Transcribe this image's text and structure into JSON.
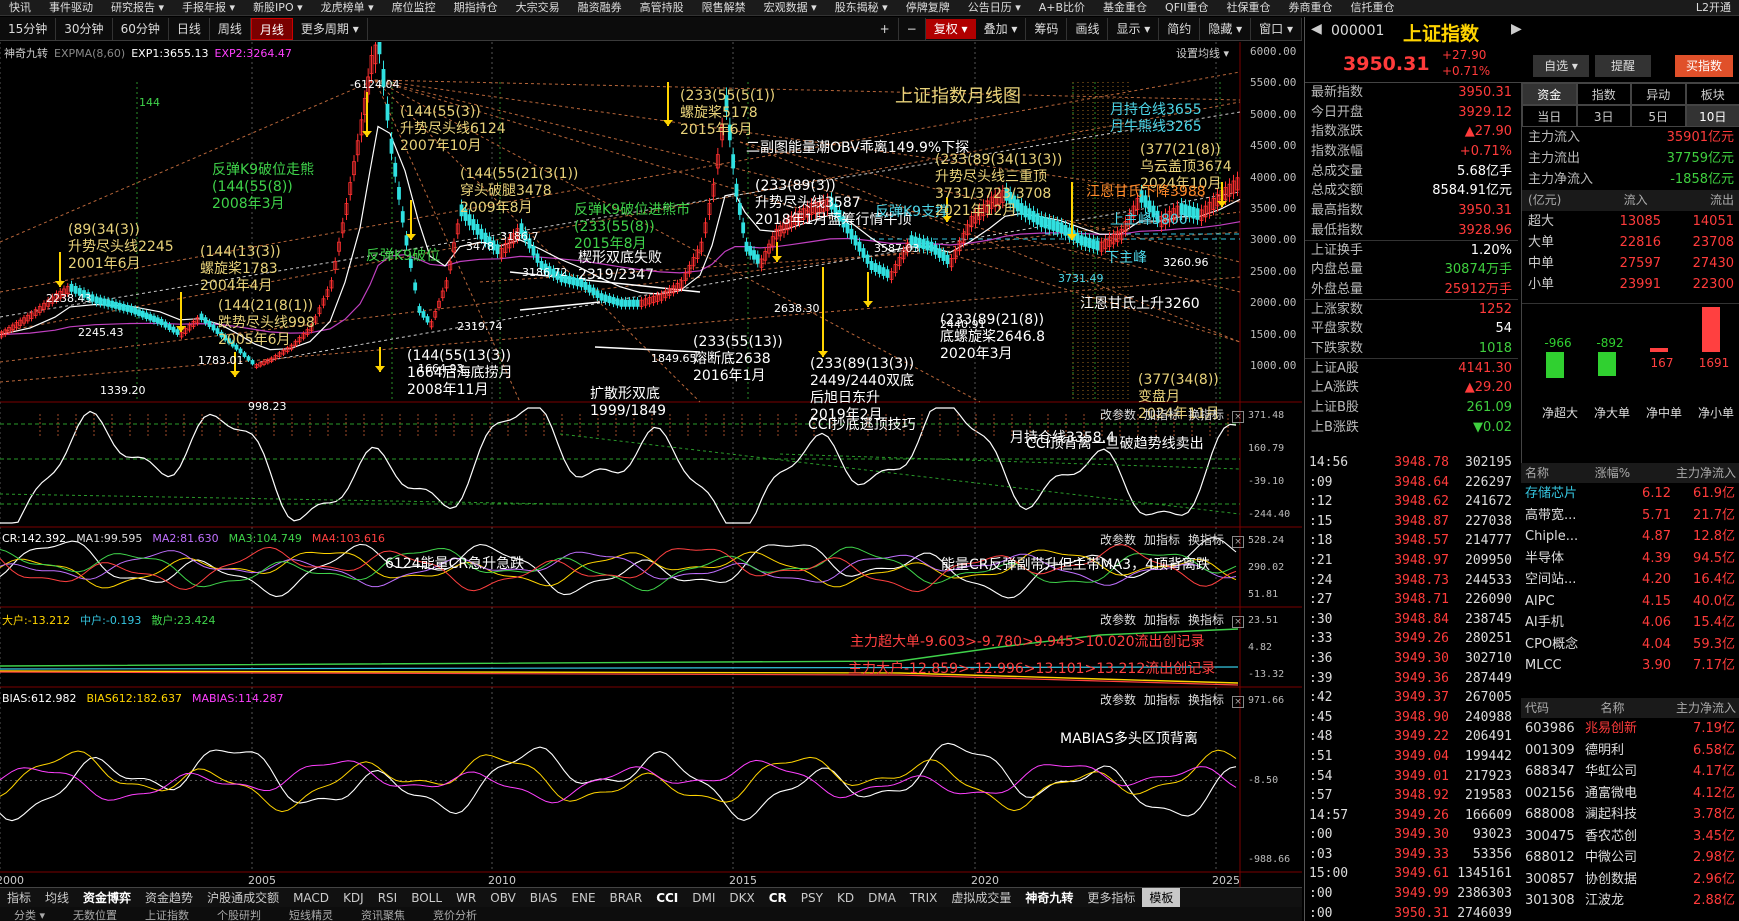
{
  "top_menu": {
    "items": [
      "快讯",
      "事件驱动",
      "研究报告 ▾",
      "手报年报 ▾",
      "新股IPO ▾",
      "龙虎榜单 ▾",
      "席位监控",
      "期指持仓",
      "大宗交易",
      "融资融券",
      "高管持股",
      "限售解禁",
      "宏观数据 ▾",
      "股东揭秘 ▾",
      "停牌复牌",
      "公告日历 ▾",
      "A+B比价",
      "基金重仓",
      "QFII重仓",
      "社保重仓",
      "券商重仓",
      "信托重仓"
    ],
    "right_label": "L2开通"
  },
  "toolbar": {
    "periods": [
      "15分钟",
      "30分钟",
      "60分钟",
      "日线",
      "周线",
      "月线",
      "更多周期 ▾"
    ],
    "selected": "月线",
    "right_buttons": [
      "+",
      "−"
    ],
    "red_button": "复权 ▾",
    "right_items": [
      "叠加 ▾",
      "筹码",
      "画线",
      "显示 ▾",
      "简约",
      "隐藏 ▾",
      "窗口 ▾"
    ]
  },
  "main_legend": {
    "indicator": "神奇九转",
    "params": "EXPMA(8,60)",
    "exp1": "EXP1:3655.13",
    "exp2": "EXP2:3264.47",
    "settings": "设置均线 ▾"
  },
  "main_y_ticks": [
    "6000.00",
    "5500.00",
    "5000.00",
    "4500.00",
    "4000.00",
    "3500.00",
    "3000.00",
    "2500.00",
    "2000.00",
    "1500.00",
    "1000.00"
  ],
  "main_title": "上证指数月线图",
  "annotations": [
    {
      "t": "-6124.04",
      "c": "w"
    },
    {
      "t": "(144(55(3))\n升势尽头线6124\n2007年10月",
      "c": ""
    },
    {
      "t": "反弹K9破位走熊\n(144(55(8))\n2008年3月",
      "c": "g"
    },
    {
      "t": "(144(55(21(3(1))\n穿头破腿3478\n2009年8月",
      "c": ""
    },
    {
      "t": "(89(34(3))\n升势尽头线2245\n2001年6月",
      "c": ""
    },
    {
      "t": "(144(13(3))\n螺旋桨1783\n2004年4月",
      "c": ""
    },
    {
      "t": "(144(21(8(1))\n跌势尽头线998\n2005年6月",
      "c": ""
    },
    {
      "t": "反弹K9破位",
      "c": "g"
    },
    {
      "t": "3186.7",
      "c": "w"
    },
    {
      "t": "楔形双底失败\n2319/2347",
      "c": "w"
    },
    {
      "t": "(144(55(13(3))\n1664后海底捞月\n2008年11月",
      "c": "w"
    },
    {
      "t": "扩散形双底\n1999/1849",
      "c": "w"
    },
    {
      "t": "反弹K9破位进熊市\n(233(55(8))\n2015年8月",
      "c": "g"
    },
    {
      "t": "(233(55(5(1))\n螺旋桨5178\n2015年6月",
      "c": ""
    },
    {
      "t": "二副图能量潮OBV乖离149.9%下探",
      "c": "w"
    },
    {
      "t": "(233(89(3))\n升势尽头线3587\n2018年1月蓝筹行情牛顶",
      "c": "w"
    },
    {
      "t": "(233(55(13))\n熔断底2638\n2016年1月",
      "c": "w"
    },
    {
      "t": "(233(89(13(3))\n2449/2440双底\n后旭日东升\n2019年2月",
      "c": "w"
    },
    {
      "t": "反弹K9支撑",
      "c": "c"
    },
    {
      "t": "(233(89(34(13(3))\n升势尽头线三重顶\n3731/3723/3708\n2021年12月",
      "c": ""
    },
    {
      "t": "(233(89(21(8))\n底螺旋桨2646.8\n2020年3月",
      "c": "w"
    },
    {
      "t": "月持仓线3655\n月牛熊线3265",
      "c": "c"
    },
    {
      "t": "(377(21(8))\n乌云盖顶3674\n2024年10月",
      "c": ""
    },
    {
      "t": "江恩甘氏下降3988",
      "c": "o"
    },
    {
      "t": "上主峰3800",
      "c": "c"
    },
    {
      "t": "下主峰",
      "c": "c"
    },
    {
      "t": "江恩甘氏上升3260",
      "c": "w"
    },
    {
      "t": "(377(34(8))\n变盘月\n2024年11月",
      "c": ""
    },
    {
      "t": "月持仓线3358.4",
      "c": "w"
    },
    {
      "t": "2238.43",
      "c": "w"
    },
    {
      "t": "2245.43",
      "c": "w"
    },
    {
      "t": "1783.01",
      "c": "w"
    },
    {
      "t": "1339.20",
      "c": "w"
    },
    {
      "t": "998.23",
      "c": "w"
    },
    {
      "t": "1664.93",
      "c": "w"
    },
    {
      "t": "2319.74",
      "c": "w"
    },
    {
      "t": "3186.72",
      "c": "w"
    },
    {
      "t": "1849.65",
      "c": "w"
    },
    {
      "t": "2638.30",
      "c": "w"
    },
    {
      "t": "3587.03",
      "c": "w"
    },
    {
      "t": "2440.91",
      "c": "w"
    },
    {
      "t": "3731.49",
      "c": "c"
    },
    {
      "t": "3260.96",
      "c": "w"
    },
    {
      "t": "3478",
      "c": "w"
    },
    {
      "t": "144",
      "c": "g"
    }
  ],
  "panels": [
    {
      "name": "cci",
      "legend": [],
      "title_left": "CCI抄底逃顶技巧",
      "title_right": "CCI顶背离一旦破趋势线卖出",
      "y_ticks": [
        "371.48",
        "160.79",
        "-39.10",
        "-244.40"
      ]
    },
    {
      "name": "cr",
      "legend": [
        {
          "t": "CR:142.392",
          "c": "#fff"
        },
        {
          "t": "MA1:99.595",
          "c": "#ddd"
        },
        {
          "t": "MA2:81.630",
          "c": "#c070ff"
        },
        {
          "t": "MA3:104.749",
          "c": "#3fd24a"
        },
        {
          "t": "MA4:103.616",
          "c": "#ff4040"
        }
      ],
      "title_left": "6124能量CR急升急跌",
      "title_right": "能量CR反弹副带升但主带MA3，4顶背离跌",
      "y_ticks": [
        "528.24",
        "290.02",
        "51.81"
      ]
    },
    {
      "name": "funds",
      "legend": [
        {
          "t": "大户:-13.212",
          "c": "#ffd400"
        },
        {
          "t": "中户:-0.193",
          "c": "#35c6e0"
        },
        {
          "t": "散户:23.424",
          "c": "#3fd24a"
        }
      ],
      "title_left": "主力超大单-9.603>-9.780>9.945>10.020流出创记录",
      "title_right": "主力大户-12.859>-12.996>13.101>13.212流出创记录",
      "y_ticks": [
        "23.51",
        "4.82",
        "-13.32"
      ]
    },
    {
      "name": "bias",
      "legend": [
        {
          "t": "BIAS:612.982",
          "c": "#fff"
        },
        {
          "t": "BIAS612:182.637",
          "c": "#ffd400"
        },
        {
          "t": "MABIAS:114.287",
          "c": "#ff40ff"
        }
      ],
      "title_left": "MABIAS多头区顶背离",
      "title_right": "",
      "y_ticks": [
        "971.66",
        "-8.50",
        "-988.66"
      ]
    }
  ],
  "panel_tools": [
    "改参数",
    "加指标",
    "换指标"
  ],
  "x_years": [
    "2000",
    "2005",
    "2010",
    "2015",
    "2020",
    "2025"
  ],
  "bottom_tabs": [
    "指标",
    "均线",
    "资金博弈",
    "资金趋势",
    "沪股通成交额",
    "MACD",
    "KDJ",
    "RSI",
    "BOLL",
    "WR",
    "OBV",
    "BIAS",
    "ENE",
    "BRAR",
    "CCI",
    "DMI",
    "DKX",
    "CR",
    "PSY",
    "KD",
    "DMA",
    "TRIX",
    "虚拟成交量",
    "神奇九转",
    "更多指标",
    "模板"
  ],
  "bottom_tabs_hl": [
    "资金博弈",
    "CCI",
    "CR",
    "神奇九转"
  ],
  "bottom_tab_active": "模板",
  "bottom2": [
    "分类 ▾",
    "无数位置",
    "上证指数",
    "个股研判",
    "短线精灵",
    "资讯聚焦",
    "竞价分析"
  ],
  "quote": {
    "code": "000001",
    "name": "上证指数",
    "price": "3950.31",
    "change": "+27.90",
    "pct": "+0.71%",
    "btn_select": "自选 ▾",
    "btn_alert": "提醒",
    "btn_buy": "买指数",
    "rows": [
      [
        "最新指数",
        "3950.31",
        "red"
      ],
      [
        "今日开盘",
        "3929.12",
        "red"
      ],
      [
        "指数涨跌",
        "▲27.90",
        "red"
      ],
      [
        "指数涨幅",
        "+0.71%",
        "red"
      ],
      [
        "总成交量",
        "5.68亿手",
        "wht"
      ],
      [
        "总成交额",
        "8584.91亿元",
        "wht"
      ],
      [
        "最高指数",
        "3950.31",
        "red"
      ],
      [
        "最低指数",
        "3928.96",
        "red"
      ],
      [
        "上证换手",
        "1.20%",
        "wht"
      ],
      [
        "内盘总量",
        "30874万手",
        "grn"
      ],
      [
        "外盘总量",
        "25912万手",
        "red"
      ],
      [
        "上涨家数",
        "1252",
        "red"
      ],
      [
        "平盘家数",
        "54",
        "wht"
      ],
      [
        "下跌家数",
        "1018",
        "grn"
      ],
      [
        "上证A股",
        "4141.30",
        "red"
      ],
      [
        "上A涨跌",
        "▲29.20",
        "red"
      ],
      [
        "上证B股",
        "261.09",
        "grn"
      ],
      [
        "上B涨跌",
        "▼0.02",
        "grn"
      ]
    ]
  },
  "fund_flow": {
    "tabs1": [
      "资金",
      "指数",
      "异动",
      "板块"
    ],
    "tabs2": [
      "当日",
      "3日",
      "5日",
      "10日"
    ],
    "rows": [
      [
        "主力流入",
        "35901亿元",
        "red"
      ],
      [
        "主力流出",
        "37759亿元",
        "grn"
      ],
      [
        "主力净流入",
        "-1858亿元",
        "grn"
      ]
    ],
    "table_hdr": [
      "(亿元)",
      "流入",
      "流出"
    ],
    "table": [
      [
        "超大",
        "13085",
        "14051"
      ],
      [
        "大单",
        "22816",
        "23708"
      ],
      [
        "中单",
        "27597",
        "27430"
      ],
      [
        "小单",
        "23991",
        "22300"
      ]
    ],
    "bars": [
      {
        "label": "净超大",
        "v": -966
      },
      {
        "label": "净大单",
        "v": -892
      },
      {
        "label": "净中单",
        "v": 167
      },
      {
        "label": "净小单",
        "v": 1691
      }
    ],
    "bar_labels": [
      "-966",
      "-892",
      "167",
      "1691"
    ]
  },
  "ticks": [
    [
      "14:56",
      "3948.78",
      "302195"
    ],
    [
      ":09",
      "3948.64",
      "226297"
    ],
    [
      ":12",
      "3948.62",
      "241672"
    ],
    [
      ":15",
      "3948.87",
      "227038"
    ],
    [
      ":18",
      "3948.57",
      "214777"
    ],
    [
      ":21",
      "3948.97",
      "209950"
    ],
    [
      ":24",
      "3948.73",
      "244533"
    ],
    [
      ":27",
      "3948.71",
      "226090"
    ],
    [
      ":30",
      "3948.84",
      "238745"
    ],
    [
      ":33",
      "3949.26",
      "280251"
    ],
    [
      ":36",
      "3949.30",
      "302710"
    ],
    [
      ":39",
      "3949.36",
      "287449"
    ],
    [
      ":42",
      "3949.37",
      "267005"
    ],
    [
      ":45",
      "3948.90",
      "240988"
    ],
    [
      ":48",
      "3949.22",
      "206491"
    ],
    [
      ":51",
      "3949.04",
      "199442"
    ],
    [
      ":54",
      "3949.01",
      "217923"
    ],
    [
      ":57",
      "3948.92",
      "219583"
    ],
    [
      "14:57",
      "3949.26",
      "166609"
    ],
    [
      ":00",
      "3949.30",
      "93023"
    ],
    [
      ":03",
      "3949.33",
      "53356"
    ],
    [
      "15:00",
      "3949.61",
      "1345161"
    ],
    [
      ":00",
      "3949.99",
      "2386303"
    ],
    [
      ":00",
      "3950.31",
      "2746039"
    ]
  ],
  "sectors": {
    "hdr": [
      "名称",
      "涨幅%",
      "主力净流入"
    ],
    "rows": [
      [
        "存储芯片",
        "6.12",
        "61.9亿"
      ],
      [
        "高带宽...",
        "5.71",
        "21.7亿"
      ],
      [
        "Chiple...",
        "4.87",
        "12.8亿"
      ],
      [
        "半导体",
        "4.39",
        "94.5亿"
      ],
      [
        "空间站...",
        "4.20",
        "16.4亿"
      ],
      [
        "AIPC",
        "4.15",
        "40.0亿"
      ],
      [
        "AI手机",
        "4.06",
        "15.4亿"
      ],
      [
        "CPO概念",
        "4.04",
        "59.3亿"
      ],
      [
        "MLCC",
        "3.90",
        "7.17亿"
      ]
    ]
  },
  "stocks": {
    "hdr": [
      "代码",
      "名称",
      "主力净流入"
    ],
    "rows": [
      [
        "603986",
        "兆易创新",
        "7.19亿"
      ],
      [
        "001309",
        "德明利",
        "6.58亿"
      ],
      [
        "688347",
        "华虹公司",
        "4.17亿"
      ],
      [
        "002156",
        "通富微电",
        "4.12亿"
      ],
      [
        "688008",
        "澜起科技",
        "3.78亿"
      ],
      [
        "300475",
        "香农芯创",
        "3.45亿"
      ],
      [
        "688012",
        "中微公司",
        "2.98亿"
      ],
      [
        "300857",
        "协创数据",
        "2.96亿"
      ],
      [
        "301308",
        "江波龙",
        "2.88亿"
      ]
    ]
  }
}
